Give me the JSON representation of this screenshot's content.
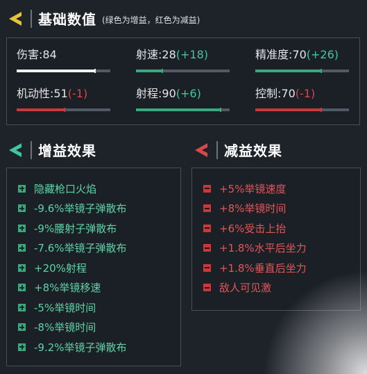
{
  "base_stats": {
    "title": "基础数值",
    "note": "(绿色为增益，红色为减益)",
    "accent_color": "#e8c23a",
    "stats": [
      {
        "label": "伤害:",
        "value": "84",
        "bonus": "",
        "level": 0.84,
        "bar_color": "#f2f2f2"
      },
      {
        "label": "射速:",
        "value": "28",
        "bonus": "(+18)",
        "level": 0.28,
        "bar_color": "#3aa97f"
      },
      {
        "label": "精准度:",
        "value": "70",
        "bonus": "(+26)",
        "level": 0.7,
        "bar_color": "#3aa97f"
      },
      {
        "label": "机动性:",
        "value": "51",
        "bonus": "(-1)",
        "level": 0.51,
        "bar_color": "#c9393c"
      },
      {
        "label": "射程:",
        "value": "90",
        "bonus": "(+6)",
        "level": 0.9,
        "bar_color": "#3aa97f"
      },
      {
        "label": "控制:",
        "value": "70",
        "bonus": "(-1)",
        "level": 0.7,
        "bar_color": "#c9393c"
      }
    ]
  },
  "buffs": {
    "title": "增益效果",
    "accent_color": "#3fc7a0",
    "items": [
      "隐藏枪口火焰",
      "-9.6%举镜子弹散布",
      "-9%腰射子弹散布",
      "-7.6%举镜子弹散布",
      "+20%射程",
      "+8%举镜移速",
      "-5%举镜时间",
      "-8%举镜时间",
      "-9.2%举镜子弹散布"
    ]
  },
  "debuffs": {
    "title": "减益效果",
    "accent_color": "#d9474a",
    "items": [
      "+5%举镜速度",
      "+8%举镜时间",
      "+6%受击上抬",
      "+1.8%水平后坐力",
      "+1.8%垂直后坐力",
      "敌人可见激"
    ]
  }
}
